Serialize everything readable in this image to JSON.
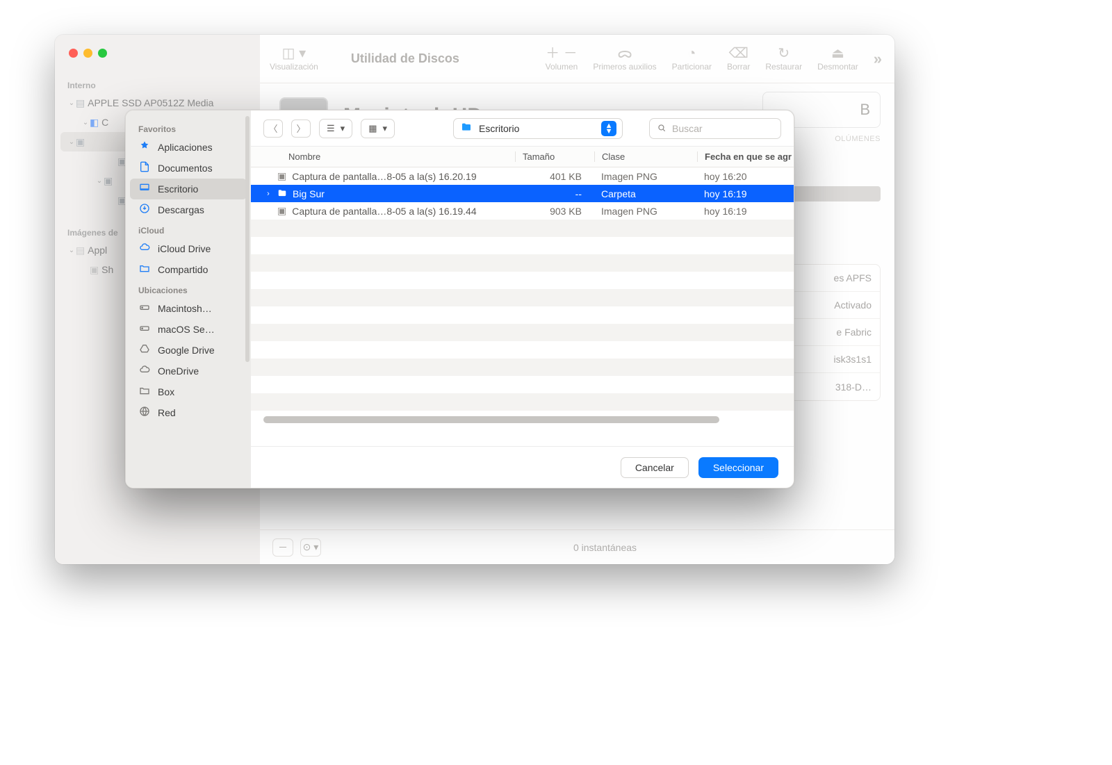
{
  "main": {
    "sidebar": {
      "section_internal": "Interno",
      "tree": [
        {
          "indent": 1,
          "name": "APPLE SSD AP0512Z Media",
          "icon": "disk",
          "chevron": "down"
        },
        {
          "indent": 2,
          "name": "C",
          "icon": "container",
          "chevron": "down"
        },
        {
          "indent": 3,
          "name": "",
          "icon": "volume",
          "chevron": "down",
          "selected": true
        },
        {
          "indent": 4,
          "name": "",
          "icon": "volume",
          "chevron": "none"
        },
        {
          "indent": 3,
          "name": "",
          "icon": "volume",
          "chevron": "down"
        },
        {
          "indent": 4,
          "name": "",
          "icon": "volume",
          "chevron": "none"
        }
      ],
      "section_images": "Imágenes de",
      "images_tree": [
        {
          "indent": 1,
          "name": "Appl",
          "icon": "dmg",
          "chevron": "down"
        },
        {
          "indent": 2,
          "name": "Sh",
          "icon": "dmg-vol",
          "chevron": "none"
        }
      ]
    },
    "toolbar": {
      "view_label": "Visualización",
      "title": "Utilidad de Discos",
      "volume_label": "Volumen",
      "firstaid_label": "Primeros auxilios",
      "partition_label": "Particionar",
      "erase_label": "Borrar",
      "restore_label": "Restaurar",
      "unmount_label": "Desmontar"
    },
    "content": {
      "volume_title": "Macintosh HD",
      "big_unit": "B",
      "volumes_label": "OLÚMENES",
      "info_rows": [
        "es APFS",
        "Activado",
        "e Fabric",
        "isk3s1s1",
        "318-D…"
      ]
    },
    "footer": {
      "snapshot_text": "0 instantáneas"
    }
  },
  "sheet": {
    "sidebar": {
      "favorites_label": "Favoritos",
      "favorites": [
        {
          "label": "Aplicaciones",
          "icon": "apps"
        },
        {
          "label": "Documentos",
          "icon": "doc"
        },
        {
          "label": "Escritorio",
          "icon": "desktop",
          "selected": true
        },
        {
          "label": "Descargas",
          "icon": "download"
        }
      ],
      "icloud_label": "iCloud",
      "icloud": [
        {
          "label": "iCloud Drive",
          "icon": "cloud"
        },
        {
          "label": "Compartido",
          "icon": "shared"
        }
      ],
      "locations_label": "Ubicaciones",
      "locations": [
        {
          "label": "Macintosh…",
          "icon": "hdd"
        },
        {
          "label": "macOS Se…",
          "icon": "hdd"
        },
        {
          "label": "Google Drive",
          "icon": "gdrive"
        },
        {
          "label": "OneDrive",
          "icon": "cloud-gray"
        },
        {
          "label": "Box",
          "icon": "box"
        },
        {
          "label": "Red",
          "icon": "globe"
        }
      ]
    },
    "toolbar": {
      "location": "Escritorio",
      "search_placeholder": "Buscar"
    },
    "columns": {
      "name": "Nombre",
      "size": "Tamaño",
      "kind": "Clase",
      "date": "Fecha en que se agr"
    },
    "files": [
      {
        "name": "Captura de pantalla…8-05 a la(s) 16.20.19",
        "size": "401 KB",
        "kind": "Imagen PNG",
        "date": "hoy 16:20",
        "icon": "img"
      },
      {
        "name": "Big Sur",
        "size": "--",
        "kind": "Carpeta",
        "date": "hoy 16:19",
        "icon": "folder",
        "expandable": true,
        "selected": true
      },
      {
        "name": "Captura de pantalla…8-05 a la(s) 16.19.44",
        "size": "903 KB",
        "kind": "Imagen PNG",
        "date": "hoy 16:19",
        "icon": "img"
      }
    ],
    "footer": {
      "cancel": "Cancelar",
      "select": "Seleccionar"
    }
  }
}
